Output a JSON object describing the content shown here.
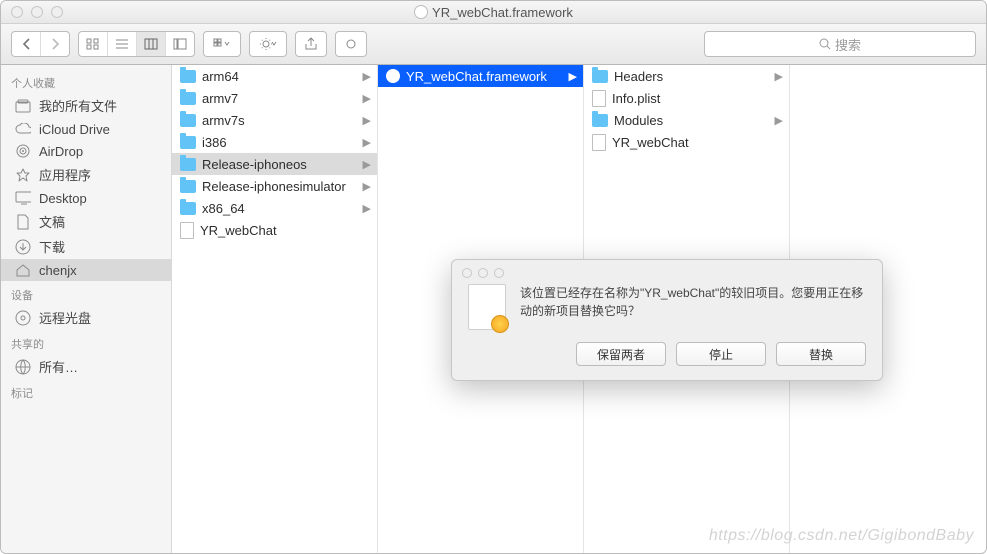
{
  "window": {
    "title": "YR_webChat.framework"
  },
  "search": {
    "placeholder": "搜索"
  },
  "sidebar": {
    "sections": [
      {
        "header": "个人收藏",
        "items": [
          {
            "label": "我的所有文件",
            "icon": "all-files"
          },
          {
            "label": "iCloud Drive",
            "icon": "icloud"
          },
          {
            "label": "AirDrop",
            "icon": "airdrop"
          },
          {
            "label": "应用程序",
            "icon": "apps"
          },
          {
            "label": "Desktop",
            "icon": "desktop"
          },
          {
            "label": "文稿",
            "icon": "documents"
          },
          {
            "label": "下载",
            "icon": "downloads"
          },
          {
            "label": "chenjx",
            "icon": "home",
            "selected": true
          }
        ]
      },
      {
        "header": "设备",
        "items": [
          {
            "label": "远程光盘",
            "icon": "disc"
          }
        ]
      },
      {
        "header": "共享的",
        "items": [
          {
            "label": "所有…",
            "icon": "network"
          }
        ]
      },
      {
        "header": "标记",
        "items": []
      }
    ]
  },
  "columns": [
    {
      "items": [
        {
          "label": "arm64",
          "type": "folder",
          "hasChildren": true
        },
        {
          "label": "armv7",
          "type": "folder",
          "hasChildren": true
        },
        {
          "label": "armv7s",
          "type": "folder",
          "hasChildren": true
        },
        {
          "label": "i386",
          "type": "folder",
          "hasChildren": true
        },
        {
          "label": "Release-iphoneos",
          "type": "folder",
          "hasChildren": true,
          "selected": true
        },
        {
          "label": "Release-iphonesimulator",
          "type": "folder",
          "hasChildren": true
        },
        {
          "label": "x86_64",
          "type": "folder",
          "hasChildren": true
        },
        {
          "label": "YR_webChat",
          "type": "doc"
        }
      ]
    },
    {
      "items": [
        {
          "label": "YR_webChat.framework",
          "type": "framework",
          "hasChildren": true,
          "selected": true
        }
      ]
    },
    {
      "items": [
        {
          "label": "Headers",
          "type": "folder",
          "hasChildren": true
        },
        {
          "label": "Info.plist",
          "type": "doc"
        },
        {
          "label": "Modules",
          "type": "folder",
          "hasChildren": true
        },
        {
          "label": "YR_webChat",
          "type": "doc"
        }
      ]
    }
  ],
  "dialog": {
    "message": "该位置已经存在名称为\"YR_webChat\"的较旧项目。您要用正在移动的新项目替换它吗？",
    "buttons": {
      "keepBoth": "保留两者",
      "stop": "停止",
      "replace": "替换"
    }
  },
  "watermark": "https://blog.csdn.net/GigibondBaby"
}
